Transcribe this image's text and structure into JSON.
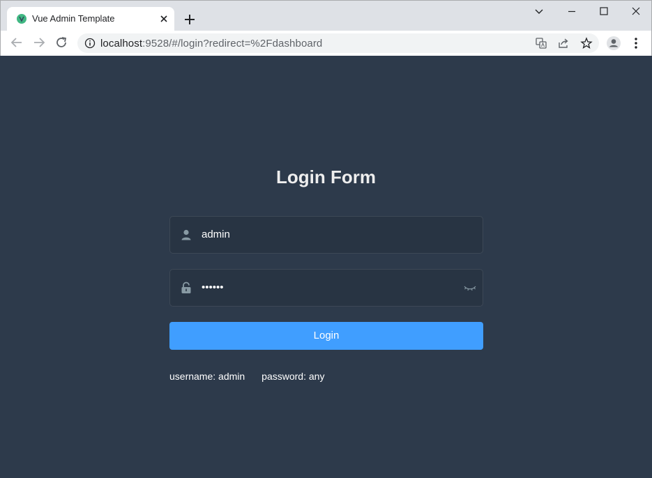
{
  "browser": {
    "tab_title": "Vue Admin Template",
    "url_host": "localhost",
    "url_rest": ":9528/#/login?redirect=%2Fdashboard",
    "favicon_color": "#41b883"
  },
  "login": {
    "title": "Login Form",
    "username_value": "admin",
    "password_value": "••••••",
    "button_label": "Login",
    "tip_username": "username: admin",
    "tip_password": "password: any",
    "accent_color": "#409eff",
    "background_color": "#2d3a4b"
  },
  "icons": {
    "user": "user-icon",
    "lock": "lock-icon",
    "eye": "eye-closed-icon"
  }
}
